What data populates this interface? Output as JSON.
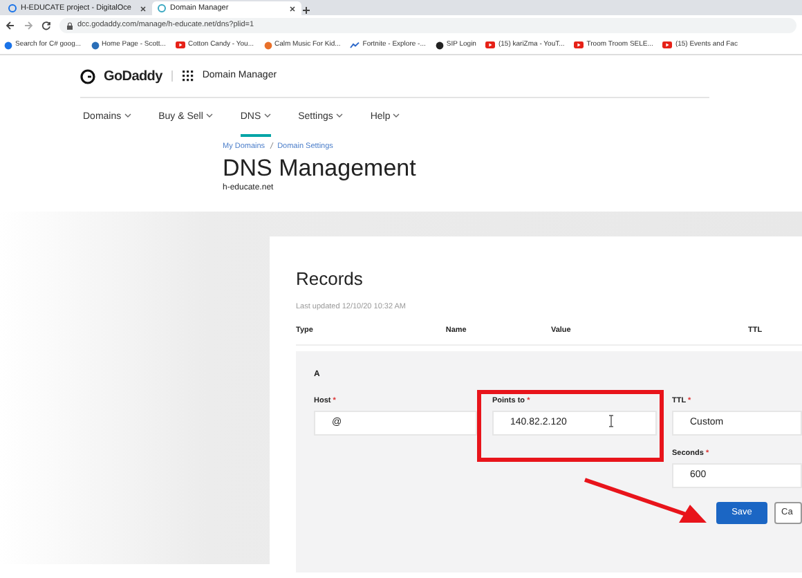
{
  "browser": {
    "tabs": [
      {
        "title": "H-EDUCATE project - DigitalOce",
        "selected": false
      },
      {
        "title": "Domain Manager",
        "selected": true
      }
    ],
    "url": "dcc.godaddy.com/manage/h-educate.net/dns?plid=1",
    "bookmarks": [
      {
        "label": "Search for C# goog...",
        "kind": "dot",
        "color": "#1a73e8"
      },
      {
        "label": "Home Page - Scott...",
        "kind": "dot",
        "color": "#2a6fb8"
      },
      {
        "label": "Cotton Candy - You...",
        "kind": "video",
        "color": "#e62117"
      },
      {
        "label": "Calm Music For Kid...",
        "kind": "dot",
        "color": "#e8702a"
      },
      {
        "label": "Fortnite - Explore -...",
        "kind": "trend",
        "color": "#2b67c9"
      },
      {
        "label": "SIP Login",
        "kind": "dot",
        "color": "#222222"
      },
      {
        "label": "(15) kariZma - YouT...",
        "kind": "video",
        "color": "#e62117"
      },
      {
        "label": "Troom Troom SELE...",
        "kind": "video",
        "color": "#e62117"
      },
      {
        "label": "(15) Events and Fac",
        "kind": "video",
        "color": "#e62117"
      }
    ]
  },
  "header": {
    "brand": "GoDaddy",
    "app": "Domain Manager",
    "nav": [
      {
        "label": "Domains",
        "selected": false
      },
      {
        "label": "Buy & Sell",
        "selected": false
      },
      {
        "label": "DNS",
        "selected": true
      },
      {
        "label": "Settings",
        "selected": false
      },
      {
        "label": "Help",
        "selected": false
      }
    ]
  },
  "breadcrumbs": [
    "My Domains",
    "Domain Settings"
  ],
  "title": "DNS Management",
  "domain": "h-educate.net",
  "records": {
    "title": "Records",
    "updated": "Last updated 12/10/20 10:32 AM",
    "columns": [
      "Type",
      "Name",
      "Value",
      "TTL"
    ],
    "editor": {
      "type": "A",
      "fields": [
        {
          "label": "Host",
          "required_mark": "*",
          "value": "@"
        },
        {
          "label": "Points to",
          "required_mark": "*",
          "value": "140.82.2.120"
        },
        {
          "label": "TTL",
          "required_mark": "*",
          "value": "Custom"
        },
        {
          "label": "Seconds",
          "required_mark": "*",
          "value": "600"
        }
      ],
      "buttons": [
        {
          "label": "Save",
          "kind": "primary"
        },
        {
          "label": "Ca",
          "kind": "secondary"
        }
      ]
    }
  }
}
